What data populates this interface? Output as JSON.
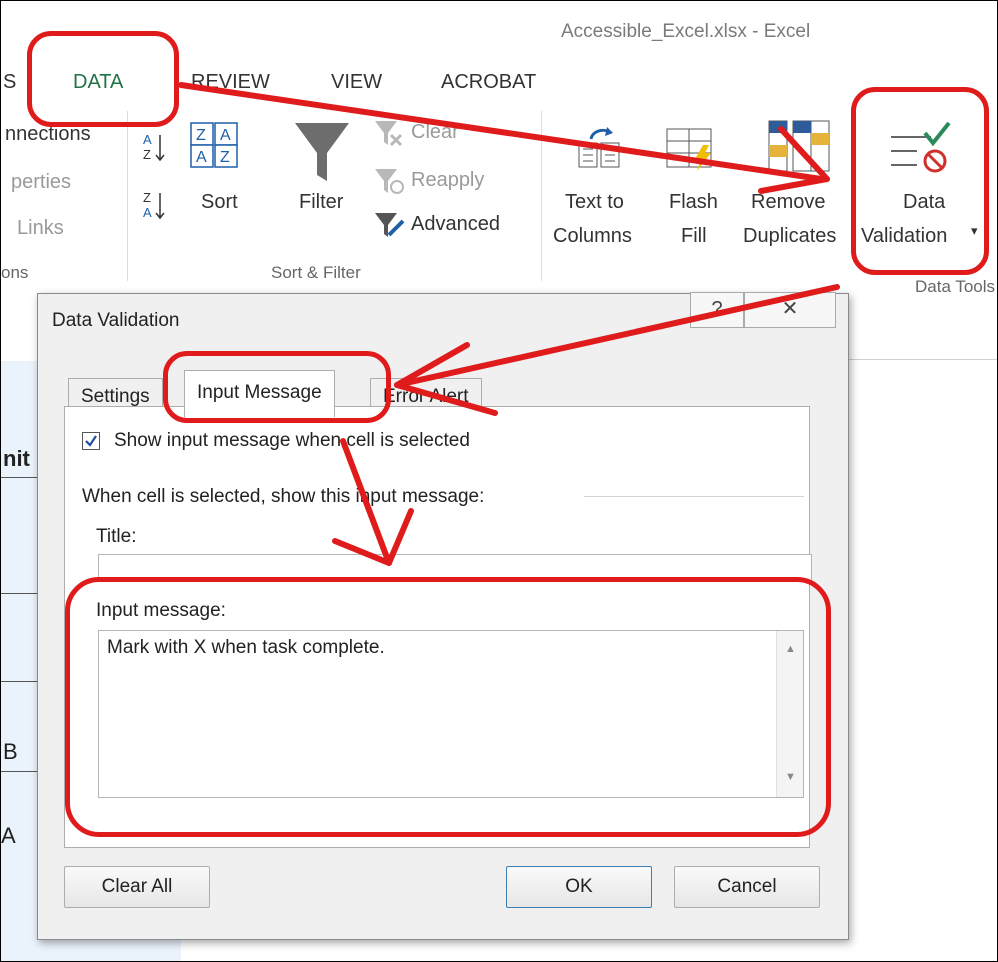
{
  "window": {
    "title": "Accessible_Excel.xlsx - Excel"
  },
  "tabs": [
    {
      "label": "S"
    },
    {
      "label": "DATA"
    },
    {
      "label": "REVIEW"
    },
    {
      "label": "VIEW"
    },
    {
      "label": "ACROBAT"
    }
  ],
  "ribbon": {
    "connections": {
      "conn": "nnections",
      "props": "perties",
      "links": "Links",
      "group": "ons"
    },
    "sort_filter": {
      "sort_label": "Sort",
      "filter_label": "Filter",
      "clear_label": "Clear",
      "reapply_label": "Reapply",
      "advanced_label": "Advanced",
      "group": "Sort & Filter",
      "az_top": "Z",
      "az_a": "A"
    },
    "data_tools": {
      "text_to_columns_1": "Text to",
      "text_to_columns_2": "Columns",
      "flash_fill_1": "Flash",
      "flash_fill_2": "Fill",
      "remove_dup_1": "Remove",
      "remove_dup_2": "Duplicates",
      "data_validation_1": "Data",
      "data_validation_2": "Validation",
      "group": "Data Tools"
    }
  },
  "sheet": {
    "partial_cells": [
      "nit",
      "B",
      "A"
    ]
  },
  "dialog": {
    "title": "Data Validation",
    "help_button": "?",
    "close_button": "✕",
    "tabs": [
      "Settings",
      "Input Message",
      "Error Alert"
    ],
    "checkbox_label": "Show input message when cell is selected",
    "checkbox_checked": true,
    "section_label": "When cell is selected, show this input message:",
    "title_label": "Title:",
    "title_value": "",
    "message_label": "Input message:",
    "message_value": "Mark with X when task complete.",
    "buttons": {
      "clear_all": "Clear All",
      "ok": "OK",
      "cancel": "Cancel"
    }
  },
  "colors": {
    "annotation": "#e01b1b",
    "data_tab": "#217346"
  }
}
